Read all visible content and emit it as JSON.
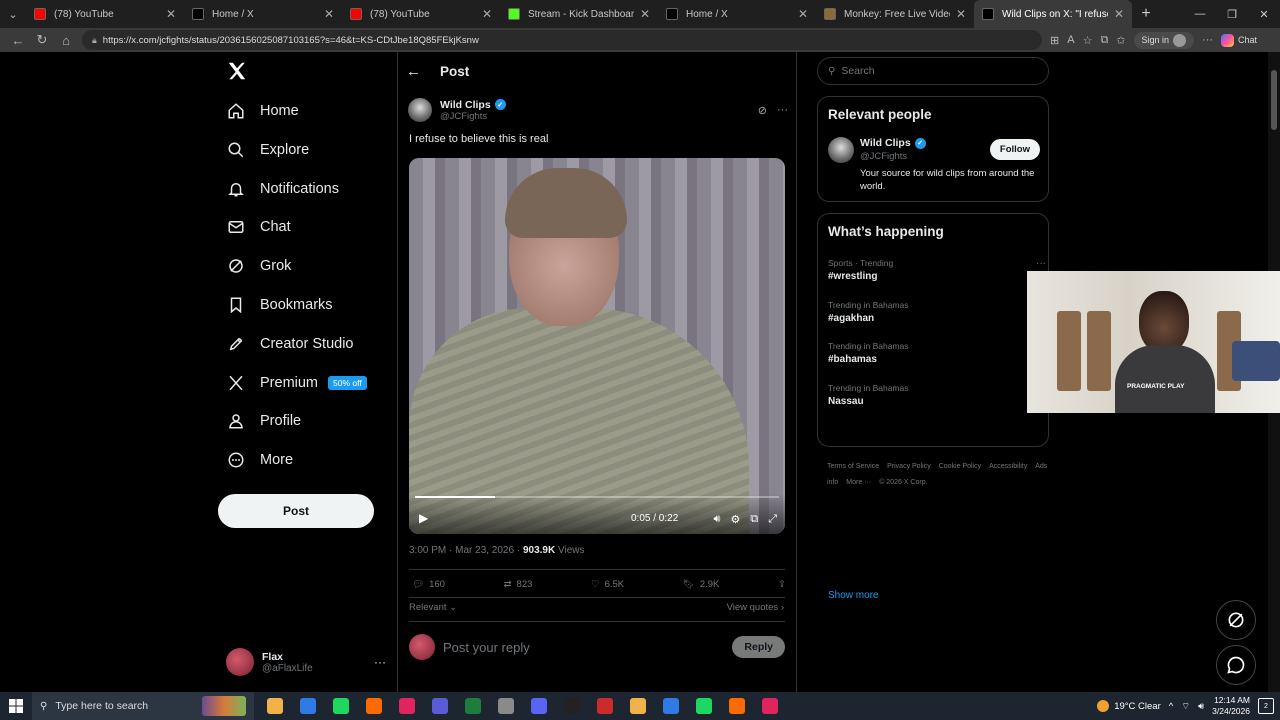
{
  "browser": {
    "tabs": [
      {
        "title": "(78) YouTube",
        "favicon_color": "#ff0000",
        "active": false
      },
      {
        "title": "Home / X",
        "favicon_color": "#000000",
        "active": false
      },
      {
        "title": "(78) YouTube",
        "favicon_color": "#ff0000",
        "active": false
      },
      {
        "title": "Stream - Kick Dashboard",
        "favicon_color": "#53fc18",
        "active": false
      },
      {
        "title": "Home / X",
        "favicon_color": "#000000",
        "active": false
      },
      {
        "title": "Monkey: Free Live Video Chat to M",
        "favicon_color": "#8b6a3a",
        "active": false
      },
      {
        "title": "Wild Clips on X: \"I refuse to believ",
        "favicon_color": "#000000",
        "active": true
      }
    ],
    "url": "https://x.com/jcfights/status/2036156025087103165?s=46&t=KS-CDtJbe18Q85FEkjKsnw",
    "signin_label": "Sign in",
    "chat_label": "Chat"
  },
  "nav": {
    "items": [
      {
        "label": "Home",
        "icon": "home-icon"
      },
      {
        "label": "Explore",
        "icon": "search-icon"
      },
      {
        "label": "Notifications",
        "icon": "bell-icon"
      },
      {
        "label": "Chat",
        "icon": "mail-icon"
      },
      {
        "label": "Grok",
        "icon": "grok-icon"
      },
      {
        "label": "Bookmarks",
        "icon": "bookmark-icon"
      },
      {
        "label": "Creator Studio",
        "icon": "rocket-icon"
      },
      {
        "label": "Premium",
        "icon": "x-icon"
      },
      {
        "label": "Profile",
        "icon": "person-icon"
      },
      {
        "label": "More",
        "icon": "more-circle-icon"
      }
    ],
    "premium_badge": "50% off",
    "post_label": "Post",
    "user": {
      "name": "Flax",
      "handle": "@aFlaxLife"
    }
  },
  "post": {
    "header": "Post",
    "author_name": "Wild Clips",
    "author_handle": "@JCFights",
    "text": "I refuse to believe this is real",
    "video": {
      "time": "0:05 / 0:22",
      "progress": 0.22
    },
    "time": "3:00 PM · Mar 23, 2026 · ",
    "views_count": "903.9K",
    "views_label": " Views",
    "stats": {
      "replies": "160",
      "reposts": "823",
      "likes": "6.5K",
      "bookmarks": "2.9K"
    },
    "relevant_label": "Relevant",
    "view_quotes_label": "View quotes",
    "reply_placeholder": "Post your reply",
    "reply_button": "Reply"
  },
  "sidebar": {
    "search_placeholder": "Search",
    "relevant_title": "Relevant people",
    "person": {
      "name": "Wild Clips",
      "handle": "@JCFights",
      "bio": "Your source for wild clips from around the world.",
      "follow_label": "Follow"
    },
    "happening_title": "What’s happening",
    "trends": [
      {
        "category": "Sports · Trending",
        "title": "#wrestling"
      },
      {
        "category": "Trending in Bahamas",
        "title": "#agakhan"
      },
      {
        "category": "Trending in Bahamas",
        "title": "#bahamas"
      },
      {
        "category": "Trending in Bahamas",
        "title": "Nassau"
      }
    ],
    "show_more": "Show more",
    "footer": [
      "Terms of Service",
      "Privacy Policy",
      "Cookie Policy",
      "Accessibility",
      "Ads info",
      "More ···",
      "© 2026 X Corp."
    ]
  },
  "webcam": {
    "shirt_text": "PRAGMATIC PLAY"
  },
  "taskbar": {
    "search_placeholder": "Type here to search",
    "weather": "19°C  Clear",
    "time": "12:14 AM",
    "date": "3/24/2026",
    "notif_count": "2",
    "app_colors": [
      "#f1b24a",
      "#2f7ae5",
      "#1ed760",
      "#ff6a00",
      "#e0245e",
      "#5b5bd6",
      "#1d7d3a",
      "#8a8a8a",
      "#5865f2",
      "#222222",
      "#cc2b2b"
    ]
  }
}
